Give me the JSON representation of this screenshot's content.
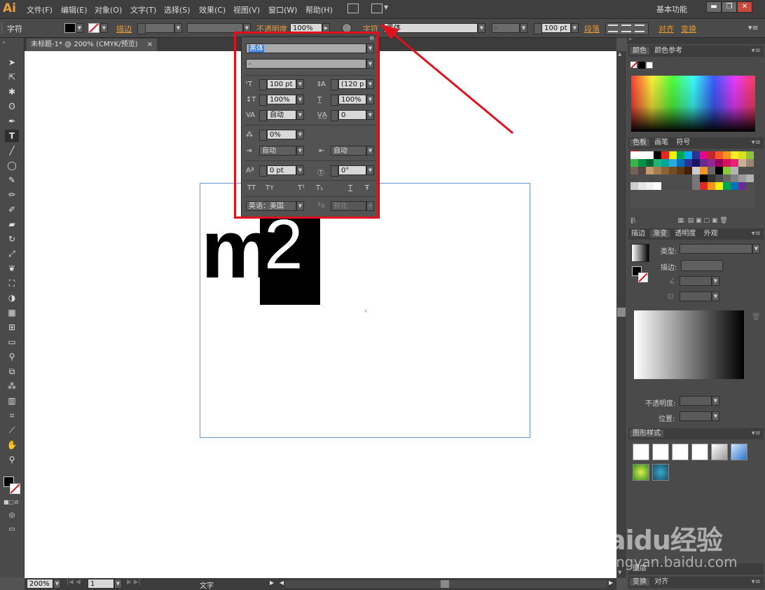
{
  "app": {
    "logo": "Ai",
    "workspace": "基本功能"
  },
  "menu": [
    "文件(F)",
    "编辑(E)",
    "对象(O)",
    "文字(T)",
    "选择(S)",
    "效果(C)",
    "视图(V)",
    "窗口(W)",
    "帮助(H)"
  ],
  "window_controls": {
    "minimize": "▬",
    "restore": "❐",
    "close": "✕"
  },
  "control_bar": {
    "mode": "字符",
    "stroke": "描边",
    "opacity_label": "不透明度",
    "opacity": "100%",
    "char_link": "字符",
    "font": "黑体",
    "font_style": "-",
    "size": "100 pt",
    "paragraph": "段落",
    "align": "对齐",
    "transform": "变换"
  },
  "document": {
    "tab_title": "未标题-1* @ 200% (CMYK/预览)",
    "close": "×"
  },
  "artwork": {
    "text": "m",
    "superscript": "2"
  },
  "char_panel": {
    "font": "黑体",
    "style": "-",
    "size": "100 pt",
    "leading": "(120 p",
    "vscale": "100%",
    "hscale": "100%",
    "kerning": "自动",
    "tracking": "0",
    "tsume": "0%",
    "aki_left": "自动",
    "aki_right": "自动",
    "baseline": "0 pt",
    "rotation": "0°",
    "tt_buttons": [
      "TT",
      "Tт",
      "T¹",
      "T₁",
      "T",
      "Ŧ"
    ],
    "language": "英语：美国",
    "aa_label": "ªa",
    "antialias": "锐化"
  },
  "status_bar": {
    "zoom": "200%",
    "page": "1",
    "tool": "文字"
  },
  "right_panels": {
    "color_tabs": [
      "颜色",
      "颜色参考"
    ],
    "swatch_tabs": [
      "色板",
      "画笔",
      "符号"
    ],
    "gradient_tabs": [
      "描边",
      "渐变",
      "透明度",
      "外观"
    ],
    "gradient": {
      "type_label": "类型:",
      "stroke_label": "描边:",
      "opacity_label": "不透明度:",
      "position_label": "位置:"
    },
    "graphic_styles_tab": "图形样式",
    "bottom_tabs": [
      "图层"
    ],
    "transform_tabs": [
      "变换",
      "对齐"
    ]
  },
  "watermark": {
    "logo": "Baidu经验",
    "url": "jingyan.baidu.com"
  },
  "colors": {
    "highlight": "#e0101c",
    "accent": "#e79a33",
    "artboard_border": "#6a93d3"
  }
}
